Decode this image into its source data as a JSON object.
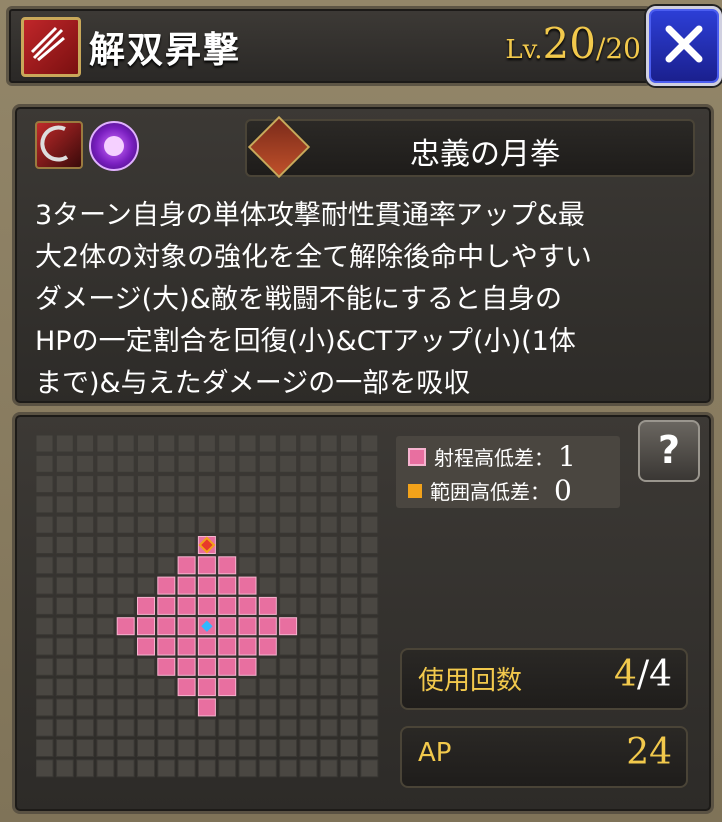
{
  "header": {
    "title": "解双昇撃",
    "level_prefix": "Lv.",
    "level_current": "20",
    "level_max": "/20"
  },
  "skill": {
    "passive_name": "忠義の月拳",
    "description_lines": [
      "3ターン自身の単体攻撃耐性貫通率アップ&最",
      "大2体の対象の強化を全て解除後命中しやすい",
      "ダメージ(大)&敵を戦闘不能にすると自身の",
      "HPの一定割合を回復(小)&CTアップ(小)(1体",
      "まで)&与えたダメージの一部を吸収"
    ]
  },
  "legend": {
    "range_height_label": "射程高低差：",
    "range_height_value": "1",
    "area_height_label": "範囲高低差：",
    "area_height_value": "0"
  },
  "stats": {
    "uses_label": "使用回数",
    "uses_current": "4",
    "uses_max": "/4",
    "ap_label": "AP",
    "ap_value": "24"
  },
  "help_label": "?",
  "colors": {
    "range_tile": "#e86fa0",
    "area_tile": "#f2a21a",
    "accent_gold": "#f2c94c",
    "close_blue": "#2d3fd8"
  }
}
